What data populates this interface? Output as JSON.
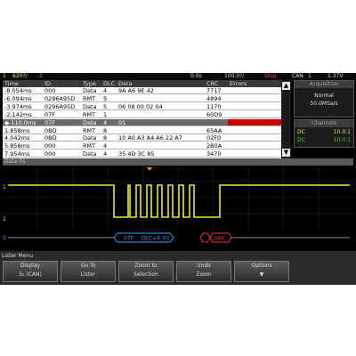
{
  "topbar": {
    "ch1": "1",
    "ch1_scale": "620?/",
    "ch2": "2",
    "delay": "0.0s",
    "timebase": "100.0?/",
    "run_state": "Stop",
    "bus_label": "CAN",
    "bus_num": "1",
    "trigger_level": "1.37V"
  },
  "lister": {
    "columns": [
      "Time",
      "ID",
      "Type",
      "DLC",
      "Data",
      "CRC",
      "Errors"
    ],
    "rows": [
      [
        "-8.054ms",
        "000",
        "Data",
        "4",
        "9A A6 9E 42",
        "7717",
        ""
      ],
      [
        "-6.094ms",
        "0296A95D",
        "RMT",
        "5",
        "",
        "4894",
        ""
      ],
      [
        "-3.974ms",
        "0296A95D",
        "Data",
        "5",
        "06 08 00 02 04",
        "1170",
        ""
      ],
      [
        "-2.142ms",
        "07F",
        "RMT",
        "1",
        "",
        "60D9",
        ""
      ],
      [
        "◆-110.0ms",
        "07F",
        "Data",
        "4",
        "01",
        "",
        ""
      ],
      [
        "1.858ms",
        "0BD",
        "RMT",
        "8",
        "",
        "65AA",
        ""
      ],
      [
        "4.042ms",
        "0BD",
        "Data",
        "8",
        "10 A0 A3 A4 A6 22 A7",
        "02F0",
        ""
      ],
      [
        "5.858ms",
        "000",
        "RMT",
        "4",
        "",
        "2B0A",
        ""
      ],
      [
        "7.954ms",
        "000",
        "Data",
        "4",
        "35 4D 3C 85",
        "3470",
        ""
      ]
    ]
  },
  "acquisition": {
    "title": "Acquisition",
    "mode": "Normal",
    "rate": "50.0MSa/s"
  },
  "channels": {
    "title": "Channels",
    "rows": [
      {
        "label": "DC",
        "value": "10.0:1"
      },
      {
        "label": "DC",
        "value": "10.0:1"
      }
    ]
  },
  "decode": {
    "label": "Data 01",
    "frame_id": "07F",
    "frame_dlc": "DLC=4",
    "frame_data": "01",
    "error_label": "ERR"
  },
  "softkeys": {
    "menu_title": "Lister Menu",
    "keys": [
      {
        "line1": "Display",
        "line2": "S₁ (CAN)"
      },
      {
        "line1": "Go To",
        "line2": "Lister"
      },
      {
        "line1": "Zoom to",
        "line2": "Selection"
      },
      {
        "line1": "Undo",
        "line2": "Zoom"
      },
      {
        "line1": "Options",
        "line2": "▼"
      }
    ]
  },
  "colors": {
    "trace": "#e8e833",
    "bus_text": "#3aa0ff",
    "error": "#ff3030"
  }
}
